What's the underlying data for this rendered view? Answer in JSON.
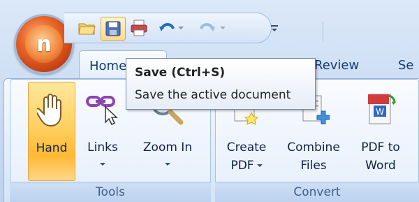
{
  "tabs": [
    {
      "label": "Home"
    },
    {
      "label": "Review"
    },
    {
      "label": "Se"
    }
  ],
  "tooltip": {
    "title": "Save (Ctrl+S)",
    "description": "Save the active document"
  },
  "qat": {
    "icons": [
      "open-folder-icon",
      "save-icon",
      "print-icon",
      "undo-icon",
      "redo-icon",
      "customize-qat-icon"
    ]
  },
  "groups": {
    "tools": {
      "caption": "Tools",
      "buttons": [
        {
          "label": "Hand"
        },
        {
          "label": "Links"
        },
        {
          "label": "Zoom In"
        }
      ]
    },
    "convert": {
      "caption": "Convert",
      "buttons": [
        {
          "label1": "Create",
          "label2": "PDF"
        },
        {
          "label1": "Combine",
          "label2": "Files"
        },
        {
          "label1": "PDF to",
          "label2": "Word"
        }
      ]
    }
  },
  "colors": {
    "orb": "#e9682b",
    "ribbon": "#e3eefb",
    "accent": "#ffd062"
  }
}
